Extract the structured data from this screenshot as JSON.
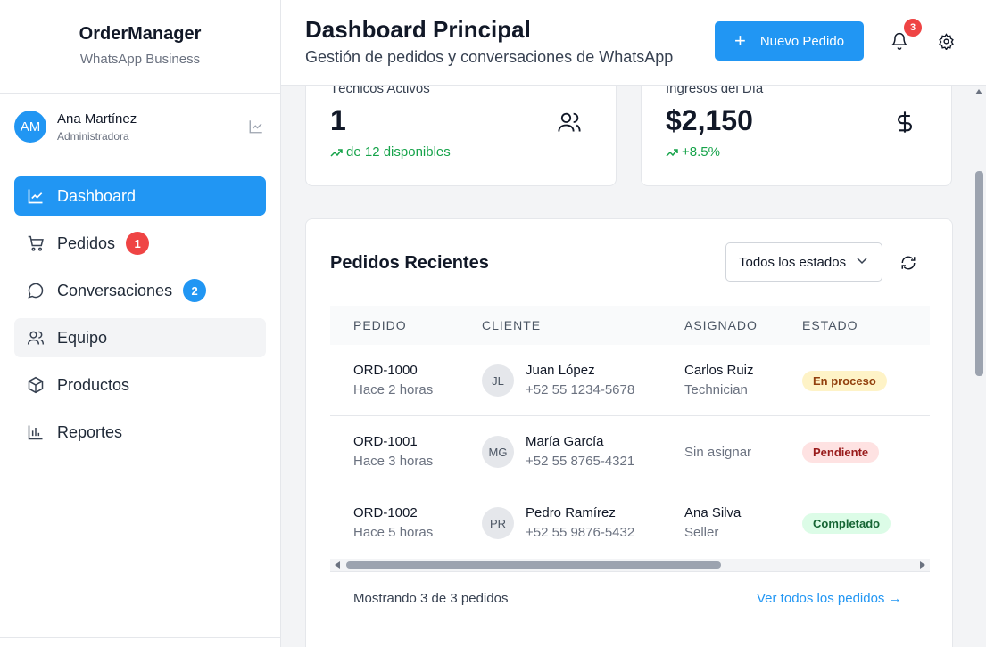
{
  "brand": {
    "title": "OrderManager",
    "subtitle": "WhatsApp Business"
  },
  "user": {
    "initials": "AM",
    "name": "Ana Martínez",
    "role": "Administradora"
  },
  "nav": [
    {
      "label": "Dashboard",
      "icon": "chart-line-icon",
      "active": true
    },
    {
      "label": "Pedidos",
      "icon": "cart-icon",
      "badge": "1",
      "badge_color": "#ef4444"
    },
    {
      "label": "Conversaciones",
      "icon": "chat-icon",
      "badge": "2",
      "badge_color": "#2196f3"
    },
    {
      "label": "Equipo",
      "icon": "users-icon"
    },
    {
      "label": "Productos",
      "icon": "box-icon"
    },
    {
      "label": "Reportes",
      "icon": "bar-chart-icon"
    }
  ],
  "header": {
    "title": "Dashboard Principal",
    "subtitle": "Gestión de pedidos y conversaciones de WhatsApp",
    "new_order_label": "Nuevo Pedido",
    "notifications_count": "3"
  },
  "stats": [
    {
      "label": "Técnicos Activos",
      "value": "1",
      "trend": "de 12 disponibles",
      "icon": "users-icon"
    },
    {
      "label": "Ingresos del Día",
      "value": "$2,150",
      "trend": "+8.5%",
      "icon": "dollar-icon"
    }
  ],
  "orders": {
    "title": "Pedidos Recientes",
    "filter_value": "Todos los estados",
    "columns": [
      "PEDIDO",
      "CLIENTE",
      "ASIGNADO",
      "ESTADO"
    ],
    "rows": [
      {
        "id": "ORD-1000",
        "time": "Hace 2 horas",
        "initials": "JL",
        "client": "Juan López",
        "phone": "+52 55 1234-5678",
        "assignee": "Carlos Ruiz",
        "assignee_role": "Technician",
        "status": "En proceso"
      },
      {
        "id": "ORD-1001",
        "time": "Hace 3 horas",
        "initials": "MG",
        "client": "María García",
        "phone": "+52 55 8765-4321",
        "assignee": "Sin asignar",
        "assignee_role": "",
        "status": "Pendiente"
      },
      {
        "id": "ORD-1002",
        "time": "Hace 5 horas",
        "initials": "PR",
        "client": "Pedro Ramírez",
        "phone": "+52 55 9876-5432",
        "assignee": "Ana Silva",
        "assignee_role": "Seller",
        "status": "Completado"
      }
    ],
    "showing": "Mostrando 3 de 3 pedidos",
    "view_all": "Ver todos los pedidos →"
  },
  "colors": {
    "accent": "#2196f3",
    "danger": "#ef4444",
    "success": "#16a34a"
  }
}
